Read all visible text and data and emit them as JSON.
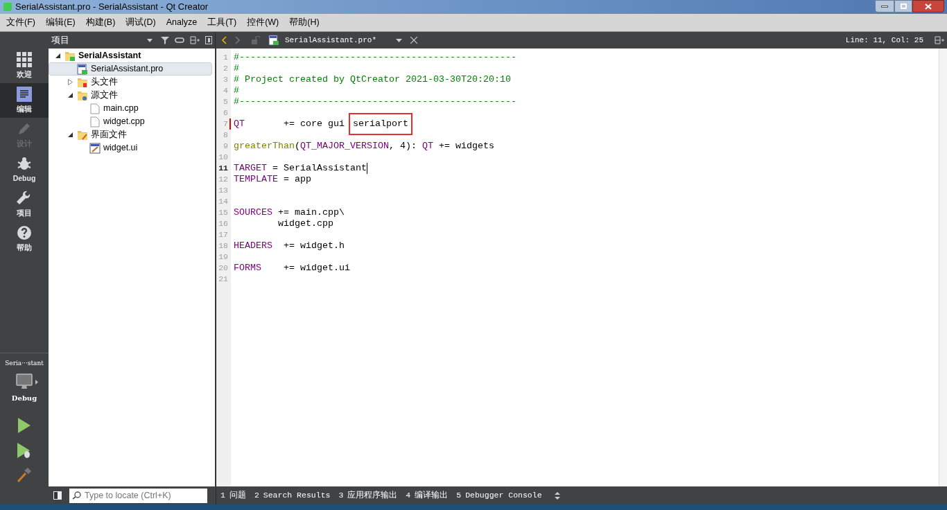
{
  "window": {
    "title": "SerialAssistant.pro - SerialAssistant - Qt Creator"
  },
  "menu": [
    "文件(F)",
    "编辑(E)",
    "构建(B)",
    "调试(D)",
    "Analyze",
    "工具(T)",
    "控件(W)",
    "帮助(H)"
  ],
  "modes": [
    {
      "label": "欢迎",
      "selected": false,
      "disabled": false
    },
    {
      "label": "编辑",
      "selected": true,
      "disabled": false
    },
    {
      "label": "设计",
      "selected": false,
      "disabled": true
    },
    {
      "label": "Debug",
      "selected": false,
      "disabled": false
    },
    {
      "label": "项目",
      "selected": false,
      "disabled": false
    },
    {
      "label": "帮助",
      "selected": false,
      "disabled": false
    }
  ],
  "kit": {
    "project": "Seria···stant",
    "build": "Debug"
  },
  "project_panel": {
    "title": "项目",
    "tree": [
      {
        "label": "SerialAssistant",
        "kind": "project",
        "selected": false,
        "expanded": true,
        "children": [
          {
            "label": "SerialAssistant.pro",
            "kind": "pro",
            "selected": true
          },
          {
            "label": "头文件",
            "kind": "folder-h",
            "selected": false,
            "expanded": false
          },
          {
            "label": "源文件",
            "kind": "folder-cpp",
            "selected": false,
            "expanded": true,
            "children": [
              {
                "label": "main.cpp",
                "kind": "file",
                "selected": false
              },
              {
                "label": "widget.cpp",
                "kind": "file",
                "selected": false
              }
            ]
          },
          {
            "label": "界面文件",
            "kind": "folder-ui",
            "selected": false,
            "expanded": true,
            "children": [
              {
                "label": "widget.ui",
                "kind": "ui",
                "selected": false
              }
            ]
          }
        ]
      }
    ]
  },
  "editor": {
    "tab": "SerialAssistant.pro*",
    "position": "Line: 11, Col: 25",
    "lines": [
      {
        "n": "1",
        "current": false,
        "modified": false,
        "tokens": [
          {
            "kind": "comment",
            "text": "#--------------------------------------------------"
          }
        ]
      },
      {
        "n": "2",
        "current": false,
        "modified": false,
        "tokens": [
          {
            "kind": "comment",
            "text": "#"
          }
        ]
      },
      {
        "n": "3",
        "current": false,
        "modified": false,
        "tokens": [
          {
            "kind": "comment",
            "text": "# Project created by QtCreator 2021-03-30T20:20:10"
          }
        ]
      },
      {
        "n": "4",
        "current": false,
        "modified": false,
        "tokens": [
          {
            "kind": "comment",
            "text": "#"
          }
        ]
      },
      {
        "n": "5",
        "current": false,
        "modified": false,
        "tokens": [
          {
            "kind": "comment",
            "text": "#--------------------------------------------------"
          }
        ]
      },
      {
        "n": "6",
        "current": false,
        "modified": false
      },
      {
        "n": "7",
        "current": false,
        "modified": true,
        "tokens": [
          {
            "kind": "keyword",
            "text": "QT"
          },
          {
            "kind": "plain",
            "text": "       += core gui "
          },
          {
            "kind": "boxed",
            "text": "serialport"
          }
        ]
      },
      {
        "n": "8",
        "current": false,
        "modified": false
      },
      {
        "n": "9",
        "current": false,
        "modified": false,
        "tokens": [
          {
            "kind": "function",
            "text": "greaterThan"
          },
          {
            "kind": "plain",
            "text": "("
          },
          {
            "kind": "keyword",
            "text": "QT_MAJOR_VERSION"
          },
          {
            "kind": "plain",
            "text": ", 4): "
          },
          {
            "kind": "keyword",
            "text": "QT"
          },
          {
            "kind": "plain",
            "text": " += widgets"
          }
        ]
      },
      {
        "n": "10",
        "current": false,
        "modified": false
      },
      {
        "n": "11",
        "current": true,
        "modified": false,
        "tokens": [
          {
            "kind": "keyword",
            "text": "TARGET"
          },
          {
            "kind": "plain",
            "text": " = SerialAssistant"
          }
        ]
      },
      {
        "n": "12",
        "current": false,
        "modified": false,
        "tokens": [
          {
            "kind": "keyword",
            "text": "TEMPLATE"
          },
          {
            "kind": "plain",
            "text": " = app"
          }
        ]
      },
      {
        "n": "13",
        "current": false,
        "modified": false
      },
      {
        "n": "14",
        "current": false,
        "modified": false
      },
      {
        "n": "15",
        "current": false,
        "modified": false,
        "tokens": [
          {
            "kind": "keyword",
            "text": "SOURCES"
          },
          {
            "kind": "plain",
            "text": " += main.cpp\\"
          }
        ]
      },
      {
        "n": "16",
        "current": false,
        "modified": false,
        "tokens": [
          {
            "kind": "plain",
            "text": "        widget.cpp"
          }
        ]
      },
      {
        "n": "17",
        "current": false,
        "modified": false
      },
      {
        "n": "18",
        "current": false,
        "modified": false,
        "tokens": [
          {
            "kind": "keyword",
            "text": "HEADERS"
          },
          {
            "kind": "plain",
            "text": "  += widget.h"
          }
        ]
      },
      {
        "n": "19",
        "current": false,
        "modified": false
      },
      {
        "n": "20",
        "current": false,
        "modified": false,
        "tokens": [
          {
            "kind": "keyword",
            "text": "FORMS"
          },
          {
            "kind": "plain",
            "text": "    += widget.ui"
          }
        ]
      },
      {
        "n": "21",
        "current": false,
        "modified": false
      }
    ]
  },
  "locator": {
    "placeholder": "Type to locate (Ctrl+K)"
  },
  "output_panes": [
    {
      "number": "1",
      "label": "问题"
    },
    {
      "number": "2",
      "label": "Search Results"
    },
    {
      "number": "3",
      "label": "应用程序输出"
    },
    {
      "number": "4",
      "label": "编译输出"
    },
    {
      "number": "5",
      "label": "Debugger Console"
    }
  ]
}
